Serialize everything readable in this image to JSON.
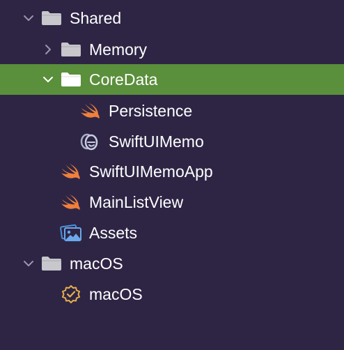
{
  "tree": {
    "items": [
      {
        "label": "Shared",
        "icon": "folder-icon",
        "expanded": true
      },
      {
        "label": "Memory",
        "icon": "folder-icon",
        "expanded": false
      },
      {
        "label": "CoreData",
        "icon": "folder-icon",
        "expanded": true,
        "selected": true
      },
      {
        "label": "Persistence",
        "icon": "swift-file-icon"
      },
      {
        "label": "SwiftUIMemo",
        "icon": "core-data-model-icon"
      },
      {
        "label": "SwiftUIMemoApp",
        "icon": "swift-file-icon"
      },
      {
        "label": "MainListView",
        "icon": "swift-file-icon"
      },
      {
        "label": "Assets",
        "icon": "asset-catalog-icon"
      },
      {
        "label": "macOS",
        "icon": "folder-icon",
        "expanded": true
      },
      {
        "label": "macOS",
        "icon": "entitlements-icon"
      }
    ]
  },
  "colors": {
    "background": "#2e2545",
    "selection": "#5a8f3b",
    "folder": "#c7c7cc",
    "swift": "#f0803c",
    "asset": "#4a90d9",
    "entitlements": "#e8b04a",
    "text": "#ffffff"
  }
}
